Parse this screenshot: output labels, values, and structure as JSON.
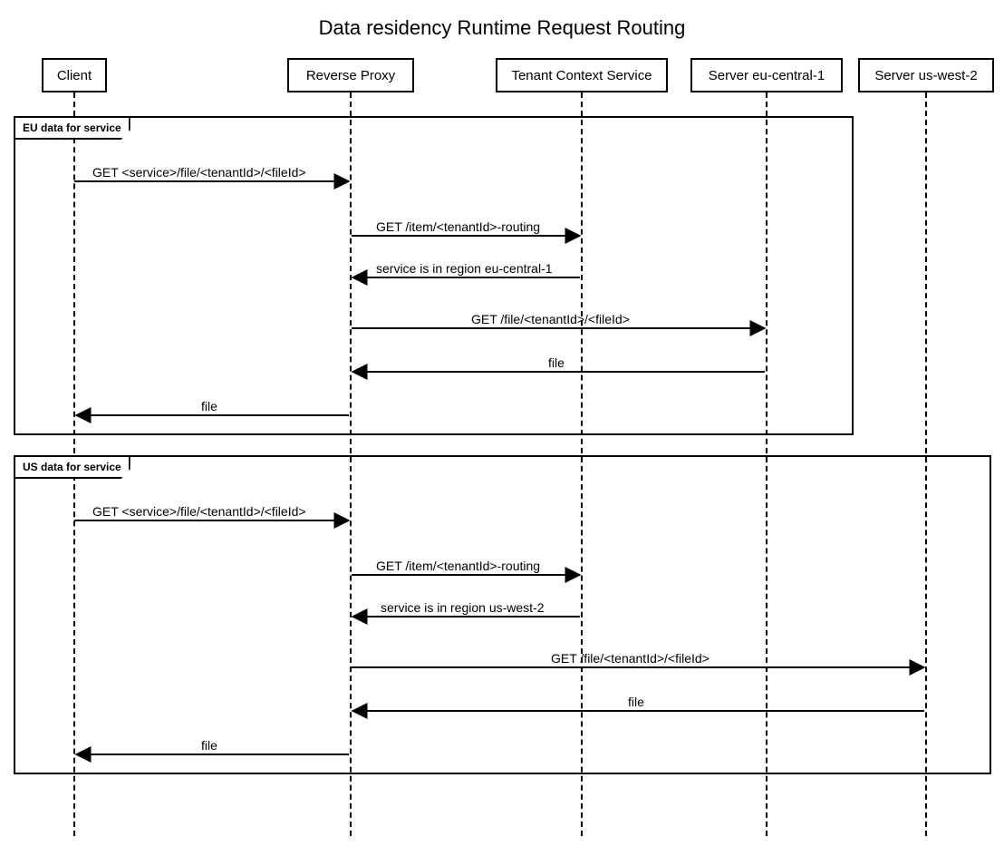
{
  "title": "Data residency Runtime Request Routing",
  "participants": {
    "client": "Client",
    "proxy": "Reverse Proxy",
    "tcs": "Tenant Context Service",
    "eu": "Server eu-central-1",
    "us": "Server us-west-2"
  },
  "groups": {
    "eu": "EU data for service",
    "us": "US data for service"
  },
  "messages": {
    "m1": "GET <service>/file/<tenantId>/<fileId>",
    "m2": "GET /item/<tenantId>-routing",
    "m3_eu": "service is in region eu-central-1",
    "m3_us": "service is in region us-west-2",
    "m4": "GET /file/<tenantId>/<fileId>",
    "m5": "file",
    "m6": "file"
  }
}
